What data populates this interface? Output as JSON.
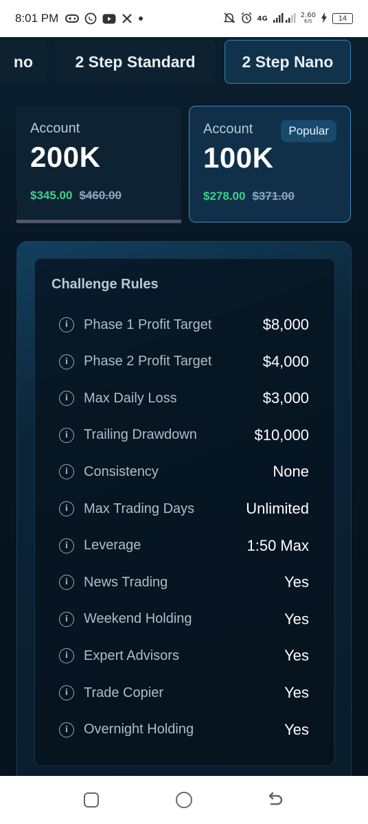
{
  "status_bar": {
    "time": "8:01 PM",
    "network": "4G",
    "speed": "2.60",
    "speed_unit": "K/S",
    "battery": "14",
    "icons": [
      "gamepad-icon",
      "whatsapp-icon",
      "youtube-icon",
      "x-icon",
      "dot-icon",
      "mute-icon",
      "alarm-icon",
      "signal-icon",
      "charging-icon"
    ]
  },
  "tabs": [
    {
      "label": "no",
      "active": false
    },
    {
      "label": "2 Step Standard",
      "active": false
    },
    {
      "label": "2 Step Nano",
      "active": true
    }
  ],
  "accounts": [
    {
      "label": "Account",
      "amount": "200K",
      "price": "$345.00",
      "original_price": "$460.00",
      "selected": false
    },
    {
      "label": "Account",
      "amount": "100K",
      "price": "$278.00",
      "original_price": "$371.00",
      "selected": true,
      "badge": "Popular"
    }
  ],
  "rules": {
    "title": "Challenge Rules",
    "items": [
      {
        "name": "Phase 1 Profit Target",
        "value": "$8,000"
      },
      {
        "name": "Phase 2 Profit Target",
        "value": "$4,000"
      },
      {
        "name": "Max Daily Loss",
        "value": "$3,000"
      },
      {
        "name": "Trailing Drawdown",
        "value": "$10,000"
      },
      {
        "name": "Consistency",
        "value": "None"
      },
      {
        "name": "Max Trading Days",
        "value": "Unlimited"
      },
      {
        "name": "Leverage",
        "value": "1:50 Max"
      },
      {
        "name": "News Trading",
        "value": "Yes"
      },
      {
        "name": "Weekend Holding",
        "value": "Yes"
      },
      {
        "name": "Expert Advisors",
        "value": "Yes"
      },
      {
        "name": "Trade Copier",
        "value": "Yes"
      },
      {
        "name": "Overnight Holding",
        "value": "Yes"
      }
    ]
  },
  "colors": {
    "accent": "#3a8fc4",
    "price_green": "#3fcf8a",
    "background": "#071521"
  }
}
